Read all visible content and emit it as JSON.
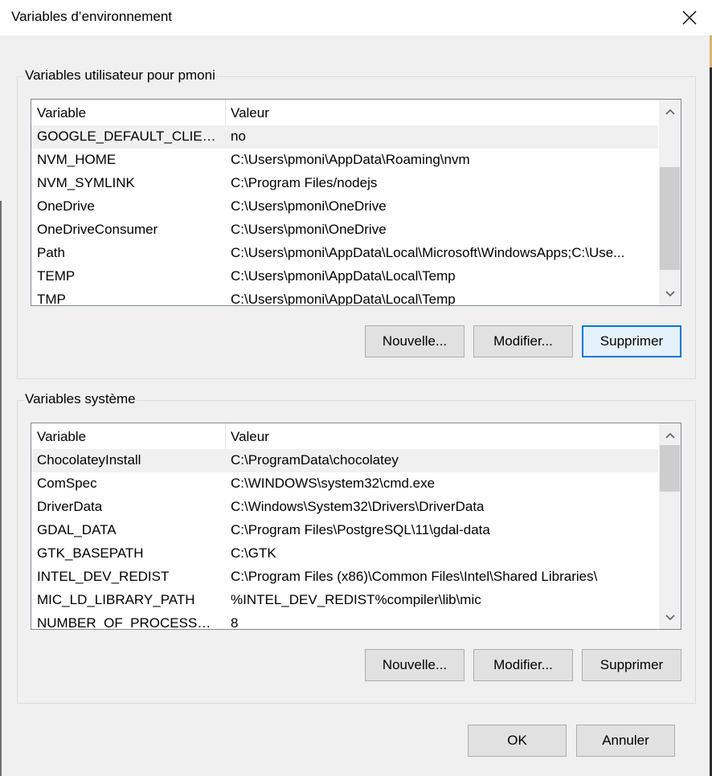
{
  "window": {
    "title": "Variables d’environnement"
  },
  "user_group": {
    "legend": "Variables utilisateur pour pmoni",
    "headers": {
      "variable": "Variable",
      "value": "Valeur"
    },
    "rows": [
      {
        "variable": "GOOGLE_DEFAULT_CLIENT_...",
        "value": "no",
        "selected": true
      },
      {
        "variable": "NVM_HOME",
        "value": "C:\\Users\\pmoni\\AppData\\Roaming\\nvm"
      },
      {
        "variable": "NVM_SYMLINK",
        "value": "C:\\Program Files/nodejs"
      },
      {
        "variable": "OneDrive",
        "value": "C:\\Users\\pmoni\\OneDrive"
      },
      {
        "variable": "OneDriveConsumer",
        "value": "C:\\Users\\pmoni\\OneDrive"
      },
      {
        "variable": "Path",
        "value": "C:\\Users\\pmoni\\AppData\\Local\\Microsoft\\WindowsApps;C:\\Use..."
      },
      {
        "variable": "TEMP",
        "value": "C:\\Users\\pmoni\\AppData\\Local\\Temp"
      },
      {
        "variable": "TMP",
        "value": "C:\\Users\\pmoni\\AppData\\Local\\Temp"
      }
    ],
    "buttons": {
      "new": "Nouvelle...",
      "edit": "Modifier...",
      "delete": "Supprimer"
    }
  },
  "system_group": {
    "legend": "Variables système",
    "headers": {
      "variable": "Variable",
      "value": "Valeur"
    },
    "rows": [
      {
        "variable": "ChocolateyInstall",
        "value": "C:\\ProgramData\\chocolatey",
        "selected": true
      },
      {
        "variable": "ComSpec",
        "value": "C:\\WINDOWS\\system32\\cmd.exe"
      },
      {
        "variable": "DriverData",
        "value": "C:\\Windows\\System32\\Drivers\\DriverData"
      },
      {
        "variable": "GDAL_DATA",
        "value": "C:\\Program Files\\PostgreSQL\\11\\gdal-data"
      },
      {
        "variable": "GTK_BASEPATH",
        "value": "C:\\GTK"
      },
      {
        "variable": "INTEL_DEV_REDIST",
        "value": "C:\\Program Files (x86)\\Common Files\\Intel\\Shared Libraries\\"
      },
      {
        "variable": "MIC_LD_LIBRARY_PATH",
        "value": "%INTEL_DEV_REDIST%compiler\\lib\\mic"
      },
      {
        "variable": "NUMBER_OF_PROCESSORS",
        "value": "8"
      }
    ],
    "buttons": {
      "new": "Nouvelle...",
      "edit": "Modifier...",
      "delete": "Supprimer"
    }
  },
  "footer": {
    "ok": "OK",
    "cancel": "Annuler"
  },
  "icons": {
    "close": "close-icon",
    "scroll_up": "chevron-up-icon",
    "scroll_down": "chevron-down-icon"
  },
  "colors": {
    "focus": "#0078d7",
    "selection": "#f0f0f0"
  }
}
